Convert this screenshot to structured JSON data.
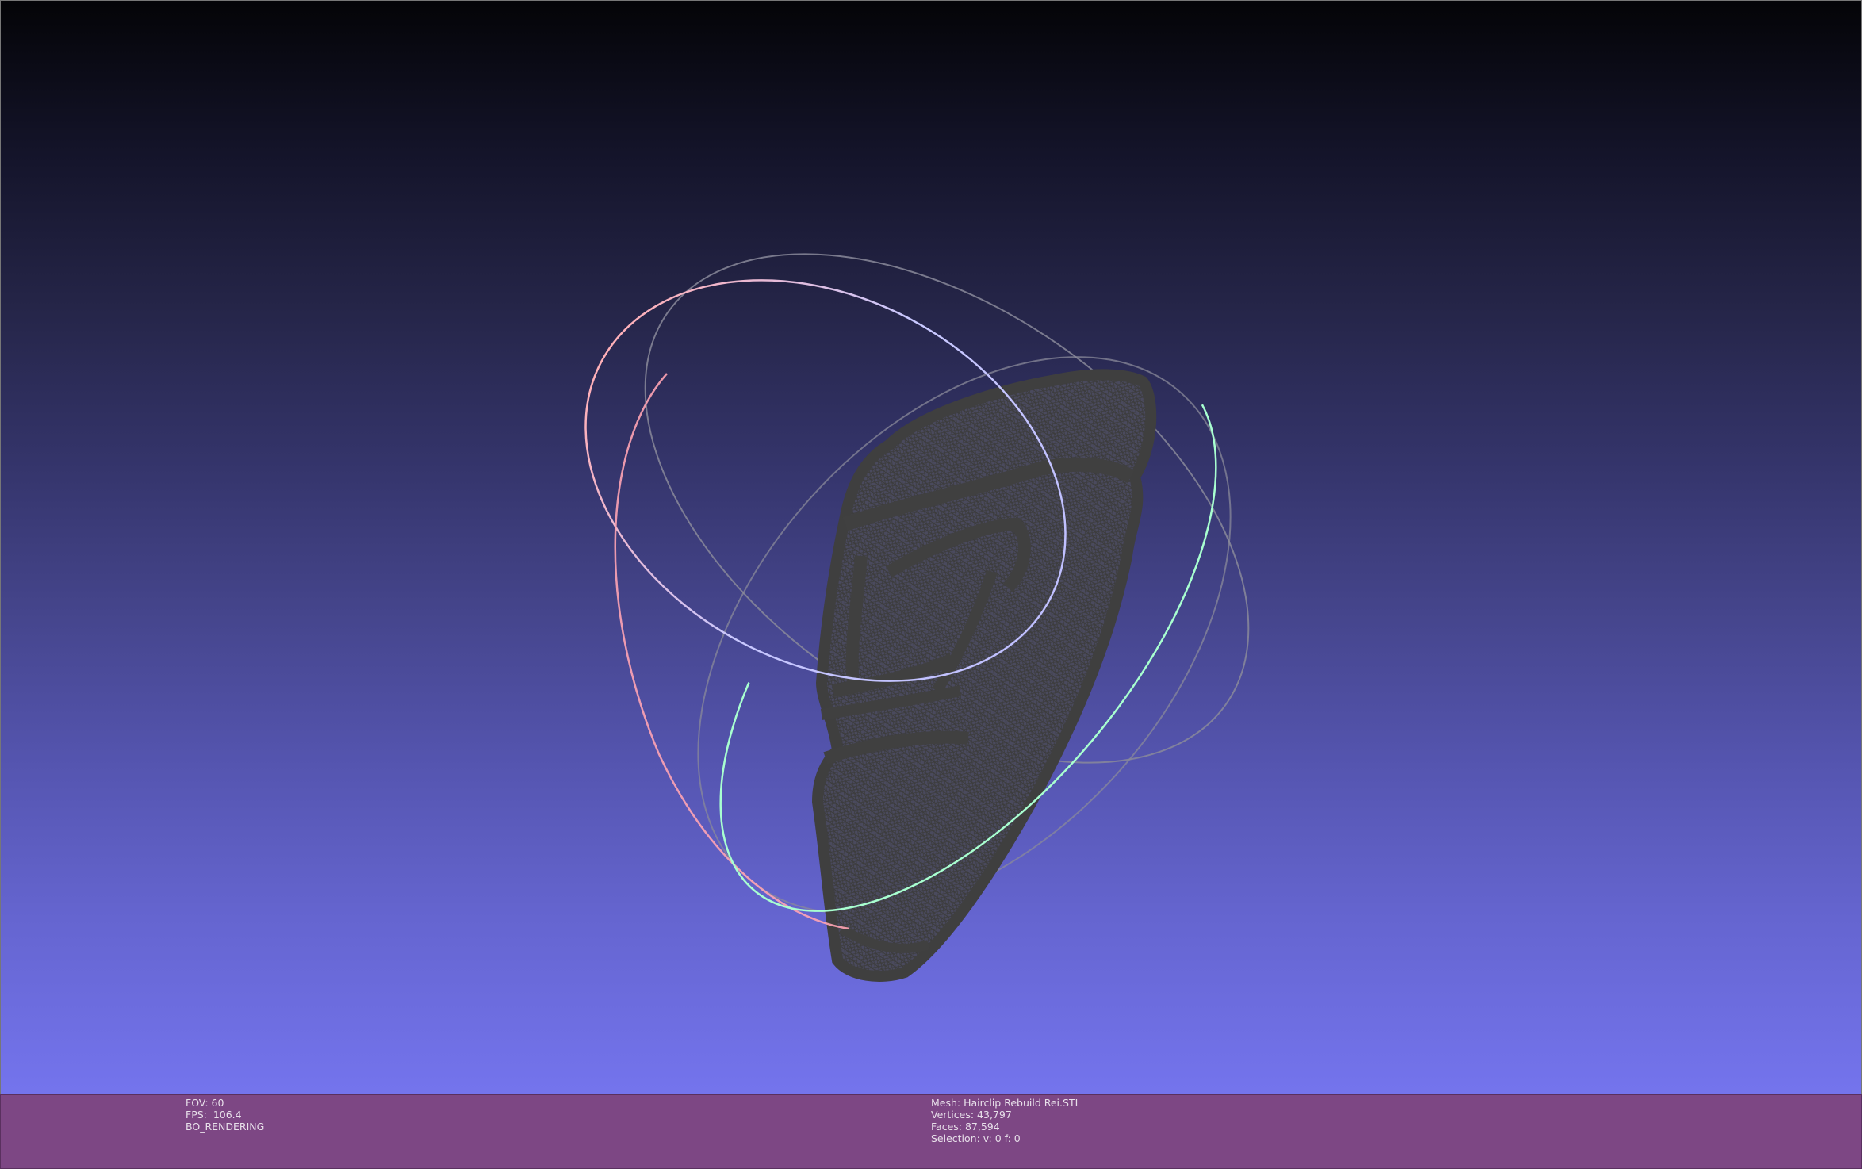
{
  "viewport": {
    "background_top": "#040407",
    "background_bottom": "#7474ed",
    "mesh_color": "#444444",
    "trackball_colors": {
      "x_ring": "#ff9fb0",
      "y_ring": "#a8ffc8",
      "z_ring": "#c0c0ff",
      "inactive_ring": "#8a8a9a"
    }
  },
  "infobar": {
    "background": "#7d4784",
    "left": {
      "fov": "FOV: 60",
      "fps": "FPS:  106.4",
      "render_mode": "BO_RENDERING"
    },
    "right": {
      "mesh": "Mesh: Hairclip Rebuild Rei.STL",
      "vertices": "Vertices: 43,797",
      "faces": "Faces: 87,594",
      "selection": "Selection: v: 0 f: 0"
    }
  }
}
